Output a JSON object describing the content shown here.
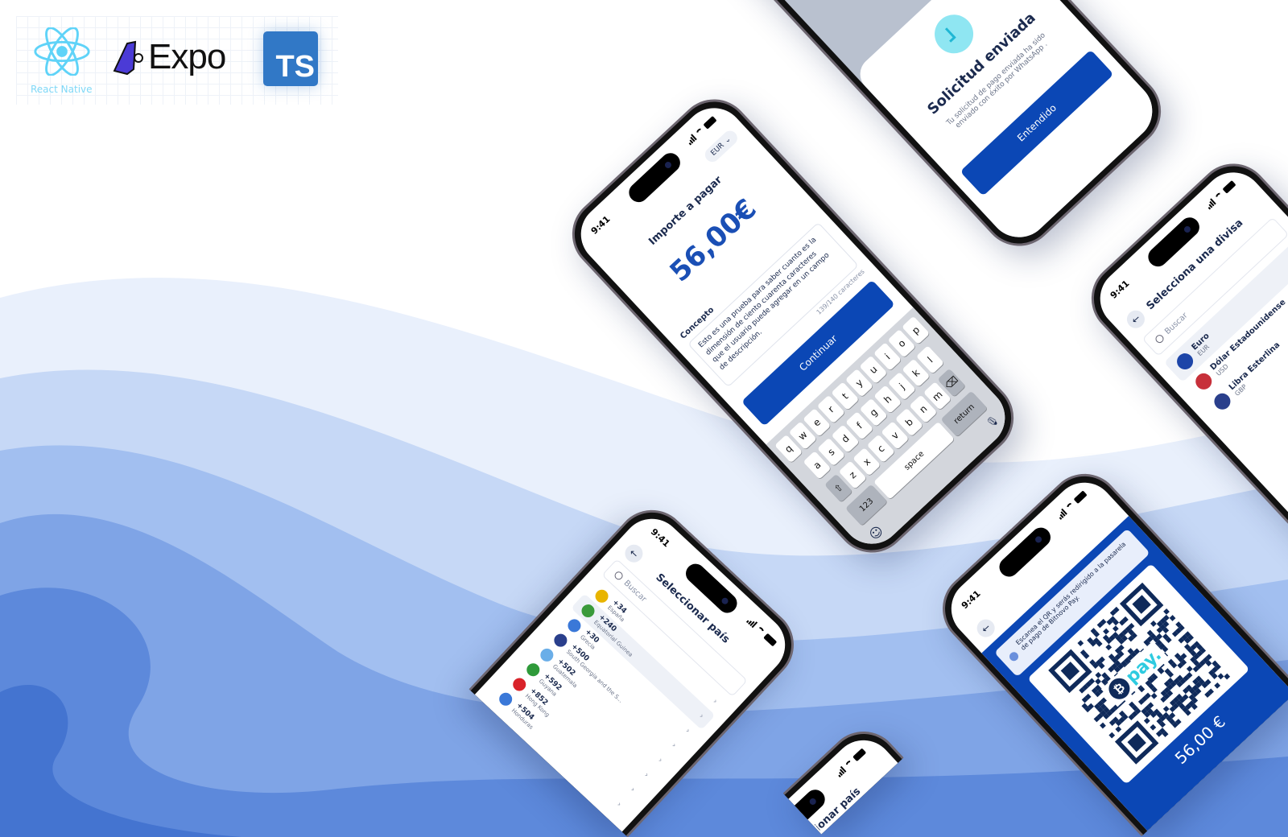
{
  "logos": {
    "react_label": "React Native",
    "expo_label": "Expo",
    "ts_label": "TS"
  },
  "colors": {
    "primary": "#0b47b5",
    "amount": "#1a4fb5",
    "ts": "#3178c6",
    "react": "#61dafb",
    "pay": "#2ecbe0"
  },
  "status_time": "9:41",
  "amount_screen": {
    "title": "Importe a pagar",
    "currency": "EUR",
    "amount": "56,00€",
    "concept_label": "Concepto",
    "concept_value": "Esto es una prueba para saber cuanto es la dimensión de ciento cuarenta caracteres que el usuario puede agregar en un campo de descripción.",
    "counter": "139/140 caracteres",
    "continue": "Continuar",
    "keyboard": {
      "rows": [
        [
          "q",
          "w",
          "e",
          "r",
          "t",
          "y",
          "u",
          "i",
          "o",
          "p"
        ],
        [
          "a",
          "s",
          "d",
          "f",
          "g",
          "h",
          "j",
          "k",
          "l"
        ],
        [
          "z",
          "x",
          "c",
          "v",
          "b",
          "n",
          "m"
        ]
      ],
      "numbers": "123",
      "space": "space",
      "return": "return",
      "shift_icon": "shift-icon",
      "delete_icon": "backspace-icon"
    }
  },
  "sent_screen": {
    "title": "Solicitud enviada",
    "message": "Tu solicitud de pago enviada ha sido enviado con éxito por WhatsApp .",
    "button": "Entendido",
    "icon": "clock-icon"
  },
  "currency_screen": {
    "title": "Selecciona una divisa",
    "search_placeholder": "Buscar",
    "items": [
      {
        "name": "Euro",
        "code": "EUR",
        "color": "#1d45a8"
      },
      {
        "name": "Dólar Estadounidense",
        "code": "USD",
        "color": "#c7303a"
      },
      {
        "name": "Libra Esterlina",
        "code": "GBP",
        "color": "#2a3f8c"
      }
    ]
  },
  "country_screen": {
    "title": "Seleccionar país",
    "search_placeholder": "Buscar",
    "items": [
      {
        "code": "+34",
        "name": "España",
        "color": "#e8b400"
      },
      {
        "code": "+240",
        "name": "Equatorial Guinea",
        "color": "#3a9a3a",
        "selected": true
      },
      {
        "code": "+30",
        "name": "Grecia",
        "color": "#3a78d8"
      },
      {
        "code": "+500",
        "name": "South Georgia and the S...",
        "color": "#2a3f8c"
      },
      {
        "code": "+502",
        "name": "Guatemala",
        "color": "#6aaee8"
      },
      {
        "code": "+592",
        "name": "Guyana",
        "color": "#2f9a3a"
      },
      {
        "code": "+852",
        "name": "Hong Kong",
        "color": "#d9232a"
      },
      {
        "code": "+504",
        "name": "Honduras",
        "color": "#3a78d8"
      }
    ]
  },
  "qr_screen": {
    "info": "Escanea el QR y serás redirigido a la pasarela de pago de Bitnovo Pay.",
    "brand": "pay.",
    "amount": "56,00 €"
  },
  "country_screen_2": {
    "title": "Seleccionar país"
  }
}
